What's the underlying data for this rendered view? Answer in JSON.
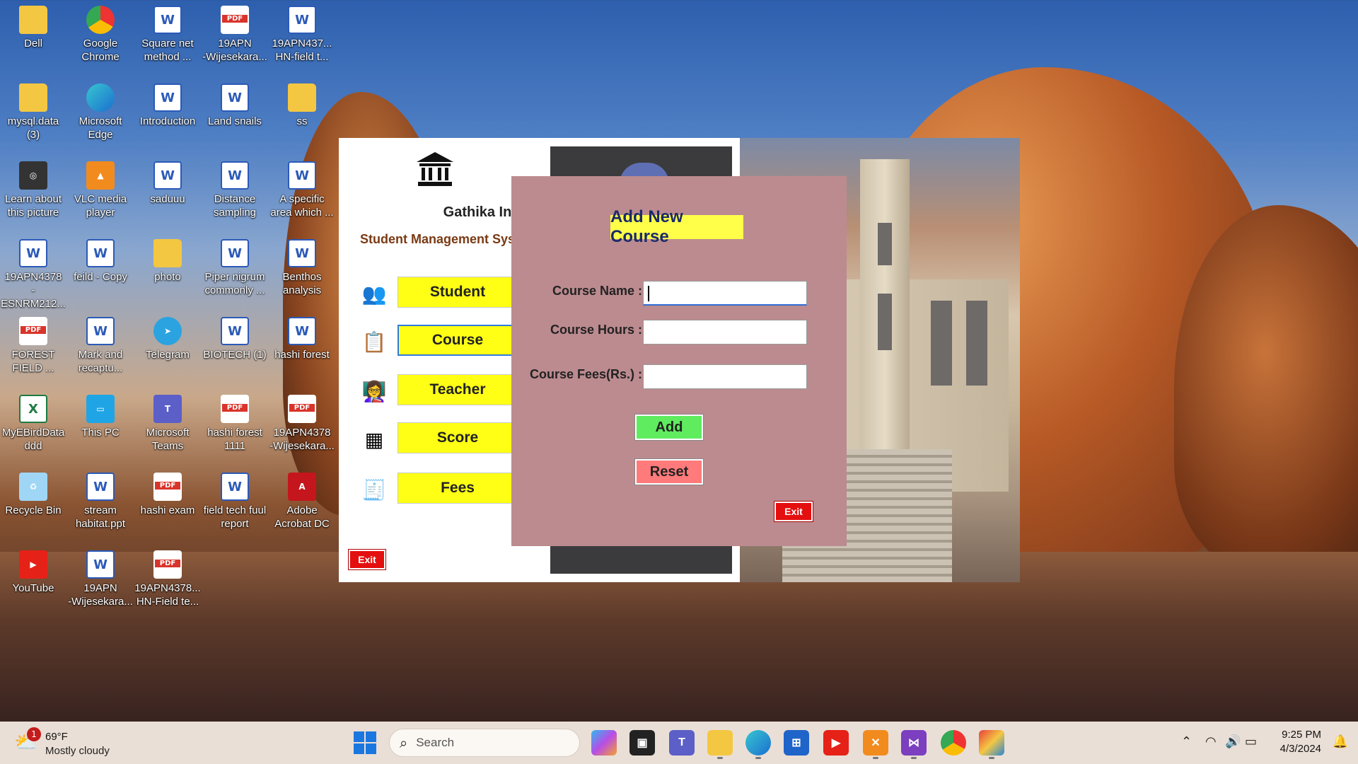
{
  "desktop": {
    "icons": [
      {
        "label": "Dell",
        "type": "folder"
      },
      {
        "label": "Google\nChrome",
        "type": "chrome"
      },
      {
        "label": "Square net\nmethod ...",
        "type": "word"
      },
      {
        "label": "19APN\n-Wijesekara...",
        "type": "pdf"
      },
      {
        "label": "19APN437...\nHN-field t...",
        "type": "word"
      },
      {
        "label": "mysql.data\n(3)",
        "type": "folder"
      },
      {
        "label": "Microsoft\nEdge",
        "type": "edge"
      },
      {
        "label": "Introduction",
        "type": "word"
      },
      {
        "label": "Land snails",
        "type": "word"
      },
      {
        "label": "ss",
        "type": "folder"
      },
      {
        "label": "Learn about\nthis picture",
        "type": "learn"
      },
      {
        "label": "VLC media\nplayer",
        "type": "vlc"
      },
      {
        "label": "saduuu",
        "type": "word"
      },
      {
        "label": "Distance\nsampling",
        "type": "word"
      },
      {
        "label": "A specific\narea which ...",
        "type": "word"
      },
      {
        "label": "19APN4378\n-ESNRM212...",
        "type": "word"
      },
      {
        "label": "feild - Copy",
        "type": "word"
      },
      {
        "label": "photo",
        "type": "folder"
      },
      {
        "label": "Piper nigrum\ncommonly ...",
        "type": "word"
      },
      {
        "label": "Benthos\nanalysis",
        "type": "word"
      },
      {
        "label": "FOREST\nFIELD ...",
        "type": "pdf"
      },
      {
        "label": "Mark and\nrecaptu...",
        "type": "word"
      },
      {
        "label": "Telegram",
        "type": "telegram"
      },
      {
        "label": "BIOTECH (1)",
        "type": "word"
      },
      {
        "label": "hashi forest",
        "type": "word"
      },
      {
        "label": "MyEBirdData\nddd",
        "type": "excel"
      },
      {
        "label": "This PC",
        "type": "pc"
      },
      {
        "label": "Microsoft\nTeams",
        "type": "teams"
      },
      {
        "label": "hashi forest\n1111",
        "type": "pdf"
      },
      {
        "label": "19APN4378\n-Wijesekara...",
        "type": "pdf"
      },
      {
        "label": "Recycle Bin",
        "type": "bin"
      },
      {
        "label": "stream\nhabitat.ppt",
        "type": "word"
      },
      {
        "label": "hashi exam",
        "type": "pdf"
      },
      {
        "label": "field tech fuul\nreport",
        "type": "word"
      },
      {
        "label": "Adobe\nAcrobat DC",
        "type": "acrobat"
      },
      {
        "label": "YouTube",
        "type": "youtube"
      },
      {
        "label": "19APN\n-Wijesekara...",
        "type": "word"
      },
      {
        "label": "19APN4378...\nHN-Field te...",
        "type": "pdf"
      }
    ]
  },
  "main_window": {
    "institute": "Gathika Institute",
    "subtitle": "Student Management System",
    "nav": [
      {
        "label": "Student",
        "icon": "students-icon"
      },
      {
        "label": "Course",
        "icon": "clipboard-icon"
      },
      {
        "label": "Teacher",
        "icon": "teacher-icon"
      },
      {
        "label": "Score",
        "icon": "score-icon"
      },
      {
        "label": "Fees",
        "icon": "fees-icon"
      }
    ],
    "exit_label": "Exit"
  },
  "dialog": {
    "title": "Add New Course",
    "fields": [
      {
        "label": "Course Name :",
        "value": ""
      },
      {
        "label": "Course Hours :",
        "value": ""
      },
      {
        "label": "Course Fees(Rs.) :",
        "value": ""
      }
    ],
    "add_label": "Add",
    "reset_label": "Reset",
    "exit_label": "Exit",
    "colors": {
      "background": "#bc8b8f",
      "title_bg": "#ffff4a",
      "add_bg": "#5fec5f",
      "reset_bg": "#ff7a7a",
      "exit_bg": "#e40f0f"
    }
  },
  "taskbar": {
    "weather_badge": "1",
    "weather_temp": "69°F",
    "weather_desc": "Mostly cloudy",
    "search_placeholder": "Search",
    "time": "9:25 PM",
    "date": "4/3/2024"
  }
}
